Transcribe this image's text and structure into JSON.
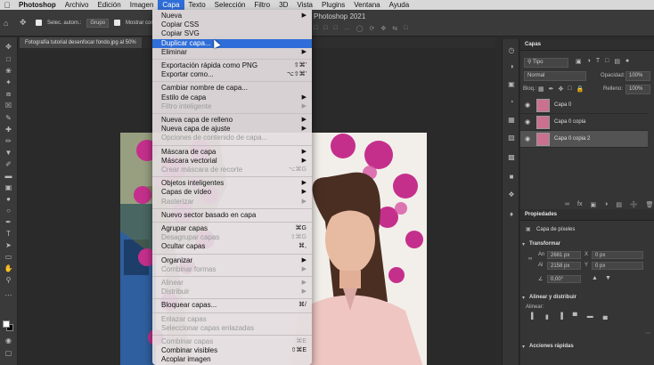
{
  "menubar": {
    "app": "Photoshop",
    "items": [
      "Archivo",
      "Edición",
      "Imagen",
      "Capa",
      "Texto",
      "Selección",
      "Filtro",
      "3D",
      "Vista",
      "Plugins",
      "Ventana",
      "Ayuda"
    ],
    "active_index": 3
  },
  "options_bar": {
    "autoselect_label": "Selec. autom.:",
    "group_select": "Grupo",
    "transform_label": "Mostrar con",
    "window_title": "Photoshop 2021"
  },
  "document_tab": "Fotografía tutorial desenfocar fondo.jpg al 50%",
  "capa_menu": {
    "items": [
      {
        "label": "Nueva",
        "submenu": true,
        "disabled": false
      },
      {
        "label": "Copiar CSS",
        "disabled": false
      },
      {
        "label": "Copiar SVG",
        "disabled": false
      },
      {
        "label": "Duplicar capa...",
        "disabled": false,
        "highlight": true
      },
      {
        "label": "Eliminar",
        "submenu": true,
        "disabled": false
      },
      {
        "sep": true
      },
      {
        "label": "Exportación rápida como PNG",
        "shortcut": "⇧⌘'",
        "disabled": false
      },
      {
        "label": "Exportar como...",
        "shortcut": "⌥⇧⌘'",
        "disabled": false
      },
      {
        "sep": true
      },
      {
        "label": "Cambiar nombre de capa...",
        "disabled": false
      },
      {
        "label": "Estilo de capa",
        "submenu": true,
        "disabled": false
      },
      {
        "label": "Filtro inteligente",
        "submenu": true,
        "disabled": true
      },
      {
        "sep": true
      },
      {
        "label": "Nueva capa de relleno",
        "submenu": true,
        "disabled": false
      },
      {
        "label": "Nueva capa de ajuste",
        "submenu": true,
        "disabled": false
      },
      {
        "label": "Opciones de contenido de capa...",
        "disabled": true
      },
      {
        "sep": true
      },
      {
        "label": "Máscara de capa",
        "submenu": true,
        "disabled": false
      },
      {
        "label": "Máscara vectorial",
        "submenu": true,
        "disabled": false
      },
      {
        "label": "Crear máscara de recorte",
        "shortcut": "⌥⌘G",
        "disabled": true
      },
      {
        "sep": true
      },
      {
        "label": "Objetos inteligentes",
        "submenu": true,
        "disabled": false
      },
      {
        "label": "Capas de vídeo",
        "submenu": true,
        "disabled": false
      },
      {
        "label": "Rasterizar",
        "submenu": true,
        "disabled": true
      },
      {
        "sep": true
      },
      {
        "label": "Nuevo sector basado en capa",
        "disabled": false
      },
      {
        "sep": true
      },
      {
        "label": "Agrupar capas",
        "shortcut": "⌘G",
        "disabled": false
      },
      {
        "label": "Desagrupar capas",
        "shortcut": "⇧⌘G",
        "disabled": true
      },
      {
        "label": "Ocultar capas",
        "shortcut": "⌘,",
        "disabled": false
      },
      {
        "sep": true
      },
      {
        "label": "Organizar",
        "submenu": true,
        "disabled": false
      },
      {
        "label": "Combinar formas",
        "submenu": true,
        "disabled": true
      },
      {
        "sep": true
      },
      {
        "label": "Alinear",
        "submenu": true,
        "disabled": true
      },
      {
        "label": "Distribuir",
        "submenu": true,
        "disabled": true
      },
      {
        "sep": true
      },
      {
        "label": "Bloquear capas...",
        "shortcut": "⌘/",
        "disabled": false
      },
      {
        "sep": true
      },
      {
        "label": "Enlazar capas",
        "disabled": true
      },
      {
        "label": "Seleccionar capas enlazadas",
        "disabled": true
      },
      {
        "sep": true
      },
      {
        "label": "Combinar capas",
        "shortcut": "⌘E",
        "disabled": true
      },
      {
        "label": "Combinar visibles",
        "shortcut": "⇧⌘E",
        "disabled": false
      },
      {
        "label": "Acoplar imagen",
        "disabled": false
      }
    ]
  },
  "layers_panel": {
    "title": "Capas",
    "filter_kind": "Tipo",
    "blend_mode": "Normal",
    "opacity_label": "Opacidad:",
    "opacity_value": "100%",
    "lock_label": "Bloq.:",
    "fill_label": "Relleno:",
    "fill_value": "100%",
    "layers": [
      {
        "name": "Capa 0",
        "selected": false
      },
      {
        "name": "Capa 0 copia",
        "selected": false
      },
      {
        "name": "Capa 0 copia 2",
        "selected": true
      }
    ]
  },
  "properties_panel": {
    "title": "Propiedades",
    "type_label": "Capa de píxeles",
    "transform_title": "Transformar",
    "w_label": "An",
    "w_value": "2681 px",
    "h_label": "Al",
    "h_value": "2158 px",
    "x_label": "X",
    "x_value": "0 px",
    "y_label": "Y",
    "y_value": "0 px",
    "angle_value": "0,00°",
    "align_title": "Alinear y distribuir",
    "align_label": "Alinear:",
    "quick_actions_title": "Acciones rápidas"
  },
  "colors": {
    "menu_highlight": "#2f6ed8",
    "panel_bg": "#353535"
  }
}
